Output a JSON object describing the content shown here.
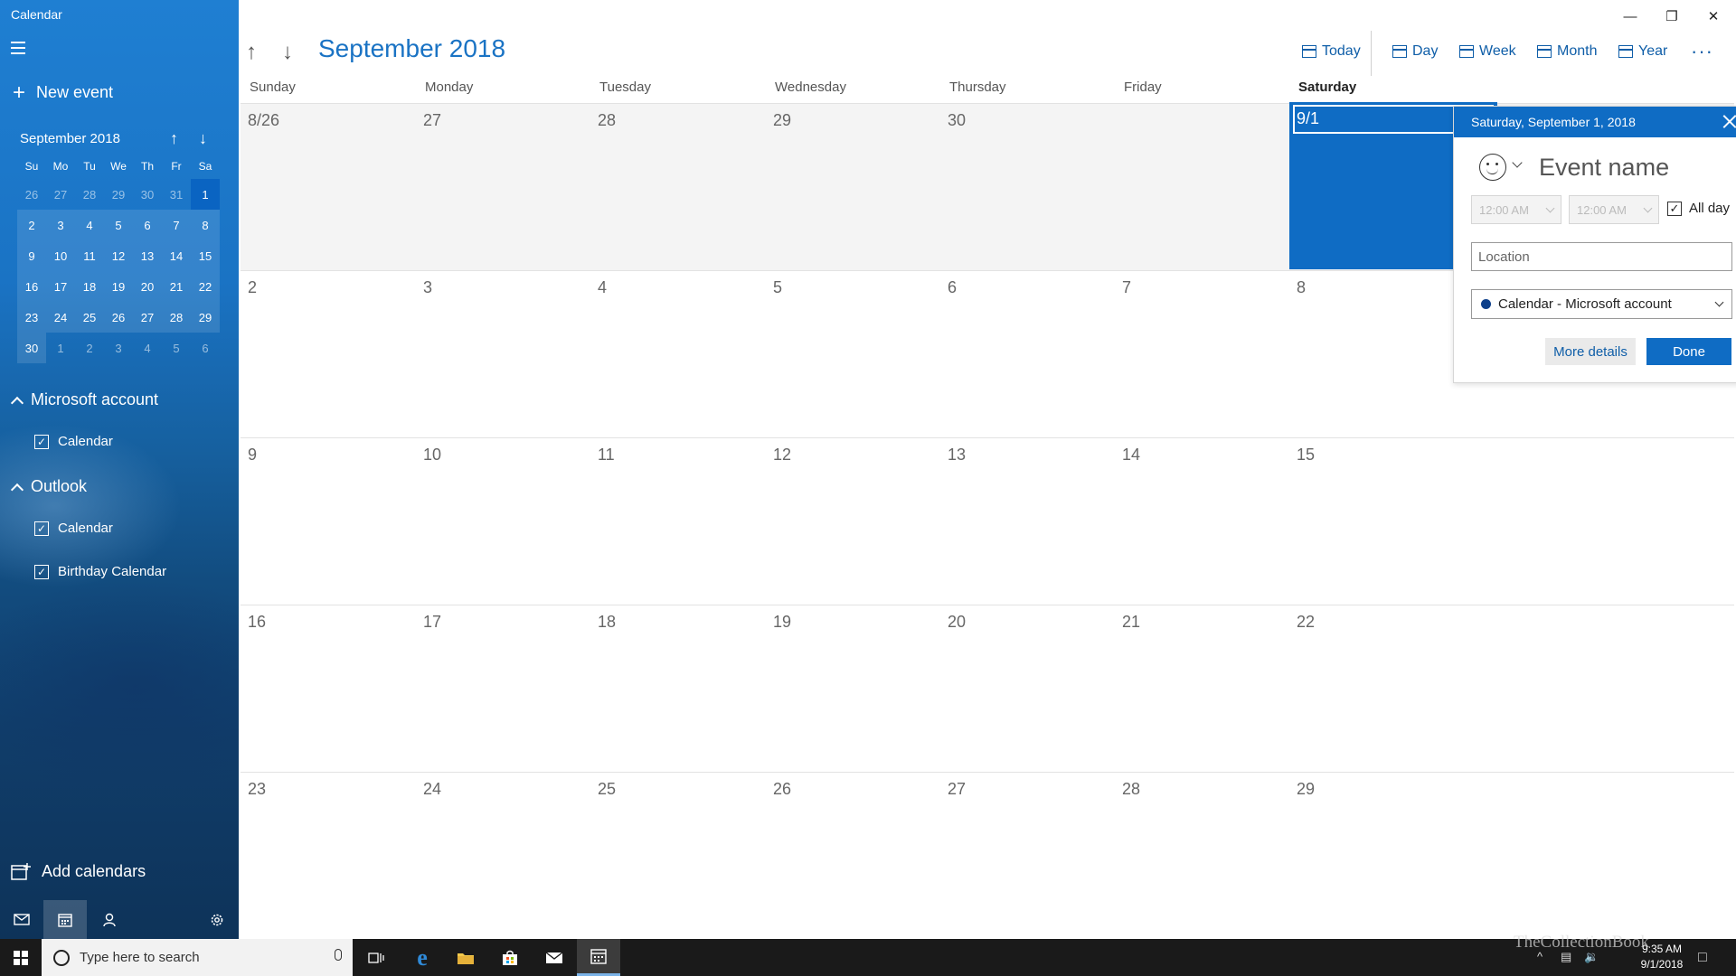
{
  "app": {
    "title": "Calendar"
  },
  "sidebar": {
    "new_event": "New event",
    "mini_calendar": {
      "title": "September 2018",
      "weekdays": [
        "Su",
        "Mo",
        "Tu",
        "We",
        "Th",
        "Fr",
        "Sa"
      ],
      "weeks": [
        [
          [
            "26",
            "out"
          ],
          [
            "27",
            "out"
          ],
          [
            "28",
            "out"
          ],
          [
            "29",
            "out"
          ],
          [
            "30",
            "out"
          ],
          [
            "31",
            "out"
          ],
          [
            "1",
            "sel"
          ]
        ],
        [
          [
            "2",
            "in"
          ],
          [
            "3",
            "in"
          ],
          [
            "4",
            "in"
          ],
          [
            "5",
            "in"
          ],
          [
            "6",
            "in"
          ],
          [
            "7",
            "in"
          ],
          [
            "8",
            "in"
          ]
        ],
        [
          [
            "9",
            "in"
          ],
          [
            "10",
            "in"
          ],
          [
            "11",
            "in"
          ],
          [
            "12",
            "in"
          ],
          [
            "13",
            "in"
          ],
          [
            "14",
            "in"
          ],
          [
            "15",
            "in"
          ]
        ],
        [
          [
            "16",
            "in"
          ],
          [
            "17",
            "in"
          ],
          [
            "18",
            "in"
          ],
          [
            "19",
            "in"
          ],
          [
            "20",
            "in"
          ],
          [
            "21",
            "in"
          ],
          [
            "22",
            "in"
          ]
        ],
        [
          [
            "23",
            "in"
          ],
          [
            "24",
            "in"
          ],
          [
            "25",
            "in"
          ],
          [
            "26",
            "in"
          ],
          [
            "27",
            "in"
          ],
          [
            "28",
            "in"
          ],
          [
            "29",
            "in"
          ]
        ],
        [
          [
            "30",
            "in"
          ],
          [
            "1",
            "out"
          ],
          [
            "2",
            "out"
          ],
          [
            "3",
            "out"
          ],
          [
            "4",
            "out"
          ],
          [
            "5",
            "out"
          ],
          [
            "6",
            "out"
          ]
        ]
      ]
    },
    "accounts": [
      {
        "name": "Microsoft account",
        "calendars": [
          "Calendar"
        ]
      },
      {
        "name": "Outlook",
        "calendars": [
          "Calendar",
          "Birthday Calendar"
        ]
      }
    ],
    "add_calendars": "Add calendars"
  },
  "toolbar": {
    "title": "September 2018",
    "today": "Today",
    "day": "Day",
    "week": "Week",
    "month": "Month",
    "year": "Year",
    "more": "···"
  },
  "month_view": {
    "weekdays": [
      "Sunday",
      "Monday",
      "Tuesday",
      "Wednesday",
      "Thursday",
      "Friday",
      "Saturday"
    ],
    "weeks": [
      [
        "8/26",
        "27",
        "28",
        "29",
        "30",
        "",
        "9/1"
      ],
      [
        "2",
        "3",
        "4",
        "5",
        "6",
        "7",
        "8"
      ],
      [
        "9",
        "10",
        "11",
        "12",
        "13",
        "14",
        "15"
      ],
      [
        "16",
        "17",
        "18",
        "19",
        "20",
        "21",
        "22"
      ],
      [
        "23",
        "24",
        "25",
        "26",
        "27",
        "28",
        "29"
      ]
    ]
  },
  "popup": {
    "header": "Saturday, September 1, 2018",
    "event_name_placeholder": "Event name",
    "start_time": "12:00 AM",
    "end_time": "12:00 AM",
    "all_day": "All day",
    "location_placeholder": "Location",
    "calendar": "Calendar - Microsoft account",
    "more_details": "More details",
    "done": "Done"
  },
  "taskbar": {
    "search_placeholder": "Type here to search",
    "time": "9:35 AM",
    "date": "9/1/2018"
  },
  "watermark": "TheCollectionBook",
  "colors": {
    "accent": "#0f6cc4",
    "link": "#0f5ea8"
  }
}
